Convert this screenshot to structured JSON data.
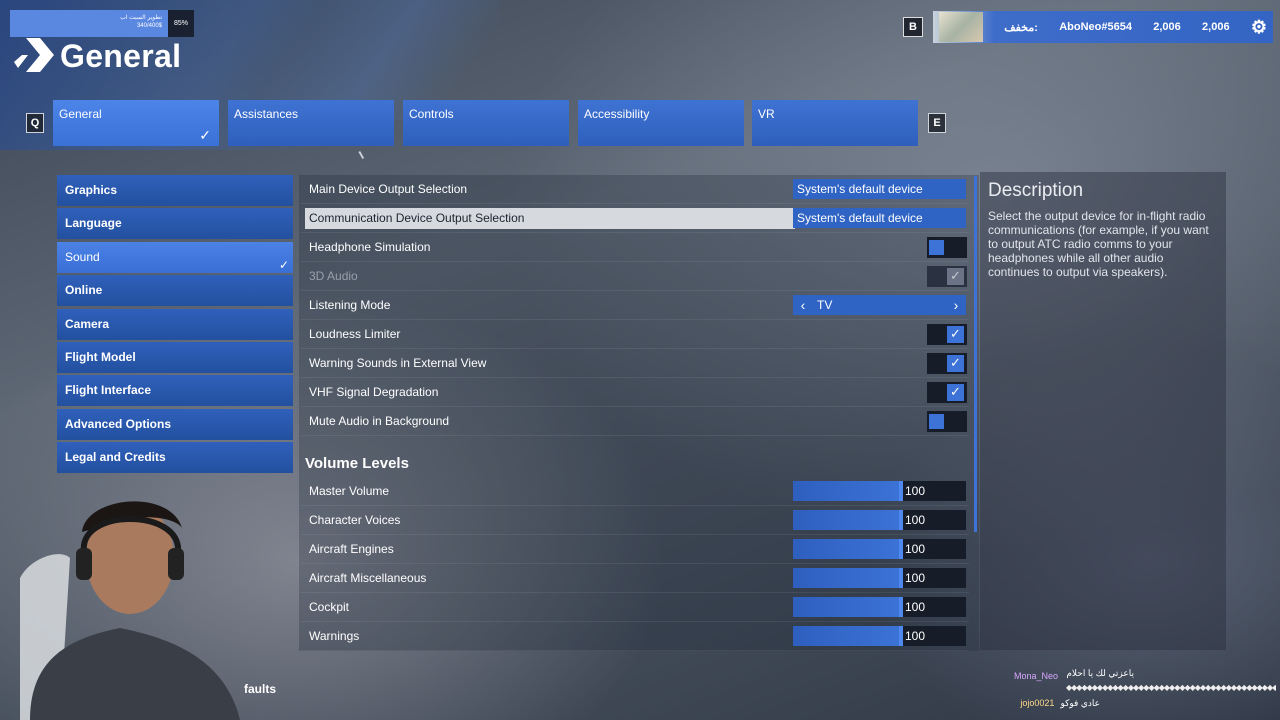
{
  "stream_overlay": {
    "progress_text": "تطوير السيت اب",
    "progress_value": "340/400$",
    "progress_fraction": 0.85,
    "progress_percent": "85%",
    "banner_user": "AboNeo#5654",
    "banner_count_1": "2,006",
    "banner_count_2": "2,006",
    "banner_arabic": "مخفف:",
    "b_key": "B"
  },
  "header": {
    "title": "General"
  },
  "tabs": {
    "left_key": "Q",
    "right_key": "E",
    "items": [
      {
        "label": "General"
      },
      {
        "label": "Assistances"
      },
      {
        "label": "Controls"
      },
      {
        "label": "Accessibility"
      },
      {
        "label": "VR"
      }
    ]
  },
  "sidebar": {
    "items": [
      {
        "label": "Graphics"
      },
      {
        "label": "Language"
      },
      {
        "label": "Sound"
      },
      {
        "label": "Online"
      },
      {
        "label": "Camera"
      },
      {
        "label": "Flight Model"
      },
      {
        "label": "Flight Interface"
      },
      {
        "label": "Advanced Options"
      },
      {
        "label": "Legal and Credits"
      }
    ]
  },
  "settings": {
    "main_device": {
      "label": "Main Device Output Selection",
      "value": "System's default device"
    },
    "comm_device": {
      "label": "Communication Device Output Selection",
      "value": "System's default device"
    },
    "headphone": {
      "label": "Headphone Simulation",
      "checked": false
    },
    "audio3d": {
      "label": "3D Audio",
      "checked": true,
      "disabled": true
    },
    "listening": {
      "label": "Listening Mode",
      "value": "TV"
    },
    "loudness": {
      "label": "Loudness Limiter",
      "checked": true
    },
    "warning_ext": {
      "label": "Warning Sounds in External View",
      "checked": true
    },
    "vhf": {
      "label": "VHF Signal Degradation",
      "checked": true
    },
    "mute_bg": {
      "label": "Mute Audio in Background",
      "checked": false
    },
    "volume_title": "Volume Levels",
    "volumes": [
      {
        "label": "Master Volume",
        "value": "100"
      },
      {
        "label": "Character Voices",
        "value": "100"
      },
      {
        "label": "Aircraft Engines",
        "value": "100"
      },
      {
        "label": "Aircraft Miscellaneous",
        "value": "100"
      },
      {
        "label": "Cockpit",
        "value": "100"
      },
      {
        "label": "Warnings",
        "value": "100"
      }
    ]
  },
  "description": {
    "title": "Description",
    "text": "Select the output device for in-flight radio communications (for example, if you want to output ATC radio comms to your headphones while all other audio continues to output via speakers)."
  },
  "footer": {
    "reset_label": "faults"
  },
  "chat": {
    "messages": [
      {
        "user": "Mona_Neo",
        "text": "ياعزتي لك يا احلام"
      },
      {
        "user": "jojo0021",
        "text": "عادي فوكو"
      }
    ]
  }
}
